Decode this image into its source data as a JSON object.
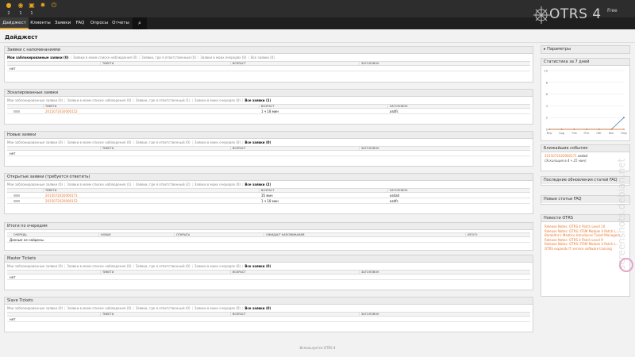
{
  "topbar": {
    "icons": [
      {
        "name": "user-icon",
        "count": "2"
      },
      {
        "name": "eye-icon",
        "count": "1"
      },
      {
        "name": "lock-icon",
        "count": "1"
      },
      {
        "name": "gear-icon",
        "count": ""
      },
      {
        "name": "power-icon",
        "count": ""
      }
    ]
  },
  "nav": {
    "items": [
      "Дайджест",
      "Клиенты",
      "Заявки",
      "FAQ",
      "Опросы",
      "Отчеты"
    ],
    "search_icon": "search-icon"
  },
  "logo": {
    "text": "OTRS 4",
    "edition": "Free"
  },
  "page_title": "Дайджест",
  "widgets": {
    "reminder": {
      "title": "Заявки с напоминаниями",
      "filters": [
        "Мои заблокированные заявки (0)",
        "Заявки в моем списке наблюдения (0)",
        "Заявки, где я ответственный (0)",
        "Заявки в моих очередях (0)",
        "Все заявки (0)"
      ],
      "columns": [
        "ТИКЕТ#",
        "ВОЗРАСТ",
        "ЗАГОЛОВОК"
      ],
      "empty": "нет"
    },
    "escalated": {
      "title": "Эскалированные заявки",
      "filters": [
        "Мои заблокированные заявки (0)",
        "Заявки в моем списке наблюдения (0)",
        "Заявки, где я ответственный (1)",
        "Заявки в моих очередях (0)",
        "Все заявки (1)"
      ],
      "columns": [
        "ТИКЕТ#",
        "ВОЗРАСТ",
        "ЗАГОЛОВОК"
      ],
      "rows": [
        {
          "ticket": "2015072020000152",
          "age": "1 ч 18 мин",
          "title": "asdfs"
        }
      ]
    },
    "new": {
      "title": "Новые заявки",
      "filters": [
        "Мои заблокированные заявки (0)",
        "Заявки в моем списке наблюдения (0)",
        "Заявки, где я ответственный (0)",
        "Заявки в моих очередях (0)",
        "Все заявки (0)"
      ],
      "columns": [
        "ТИКЕТ#",
        "ВОЗРАСТ",
        "ЗАГОЛОВОК"
      ],
      "empty": "нет"
    },
    "open": {
      "title": "Открытые заявки (требуется ответить)",
      "filters": [
        "Мои заблокированные заявки (0)",
        "Заявки в моем списке наблюдения (1)",
        "Заявки, где я ответственный (2)",
        "Заявки в моих очередях (0)",
        "Все заявки (2)"
      ],
      "columns": [
        "ТИКЕТ#",
        "ВОЗРАСТ",
        "ЗАГОЛОВОК"
      ],
      "rows": [
        {
          "ticket": "2015072020000171",
          "age": "35 мин",
          "title": "asdad"
        },
        {
          "ticket": "2015072020000152",
          "age": "1 ч 18 мин",
          "title": "asdfs"
        }
      ]
    },
    "queues": {
      "title": "Итоги по очередям",
      "columns": [
        "ОЧЕРЕДЬ",
        "НОВАЯ",
        "ОТКРЫТА",
        "ОЖИДАЕТ НАПОМИНАНИЯ",
        "ИТОГО"
      ],
      "empty": "Данные не найдены."
    },
    "master": {
      "title": "Master Tickets",
      "filters": [
        "Мои заблокированные заявки (0)",
        "Заявки в моем списке наблюдения (0)",
        "Заявки, где я ответственный (0)",
        "Заявки в моих очередях (0)",
        "Все заявки (0)"
      ],
      "columns": [
        "ТИКЕТ#",
        "ВОЗРАСТ",
        "ЗАГОЛОВОК"
      ],
      "empty": "нет"
    },
    "slave": {
      "title": "Slave Tickets",
      "filters": [
        "Мои заблокированные заявки (0)",
        "Заявки в моем списке наблюдения (0)",
        "Заявки, где я ответственный (0)",
        "Заявки в моих очередях (0)",
        "Все заявки (0)"
      ],
      "columns": [
        "ТИКЕТ#",
        "ВОЗРАСТ",
        "ЗАГОЛОВОК"
      ],
      "empty": "нет"
    }
  },
  "sidebar": {
    "params": "Параметры",
    "stats_title": "Статистика за 7 дней",
    "upcoming_title": "Ближайшие события",
    "upcoming": {
      "ticket": "2015072020000171",
      "title": "asdad",
      "note": "(Эскалация в 4 ч 25 мин)"
    },
    "faq_updates": "Последние обновления статей FAQ",
    "faq_new": "Новые статьи FAQ",
    "news_title": "Новости OTRS",
    "news": [
      "Release Notes: OTRS 4 Patch Level 10",
      "Release Notes: OTRS::ITSM Module 4 Patch L...",
      "Bambitra's Meatico Introduces Ticket Managem...",
      "Release Notes: OTRS 4 Patch Level 9",
      "Release Notes: OTRS::ITSM Module 4 Patch L...",
      "OTRS expands IT service software training"
    ]
  },
  "chart_data": {
    "type": "line",
    "title": "Статистика за 7 дней",
    "categories": [
      "Втр",
      "Срд",
      "Чтв",
      "Птн",
      "Сбт",
      "Вск",
      "Пнд"
    ],
    "y_ticks": [
      "0",
      "2",
      "4",
      "6",
      "8",
      "10"
    ],
    "ylim": [
      0,
      10
    ],
    "series": [
      {
        "color": "#4a7ab5",
        "values": [
          0,
          0,
          0,
          0,
          0,
          0,
          2
        ]
      },
      {
        "color": "#e8772e",
        "values": [
          0,
          0,
          0,
          0,
          0,
          0,
          0
        ]
      }
    ]
  },
  "footer": "Используется OTRS 4",
  "watermark": "screenshots.debian.net",
  "colors": {
    "accent": "#e8772e",
    "topbar": "#2d2d2d",
    "nav": "#1f1f1f",
    "highlight": "#e8a31d"
  }
}
